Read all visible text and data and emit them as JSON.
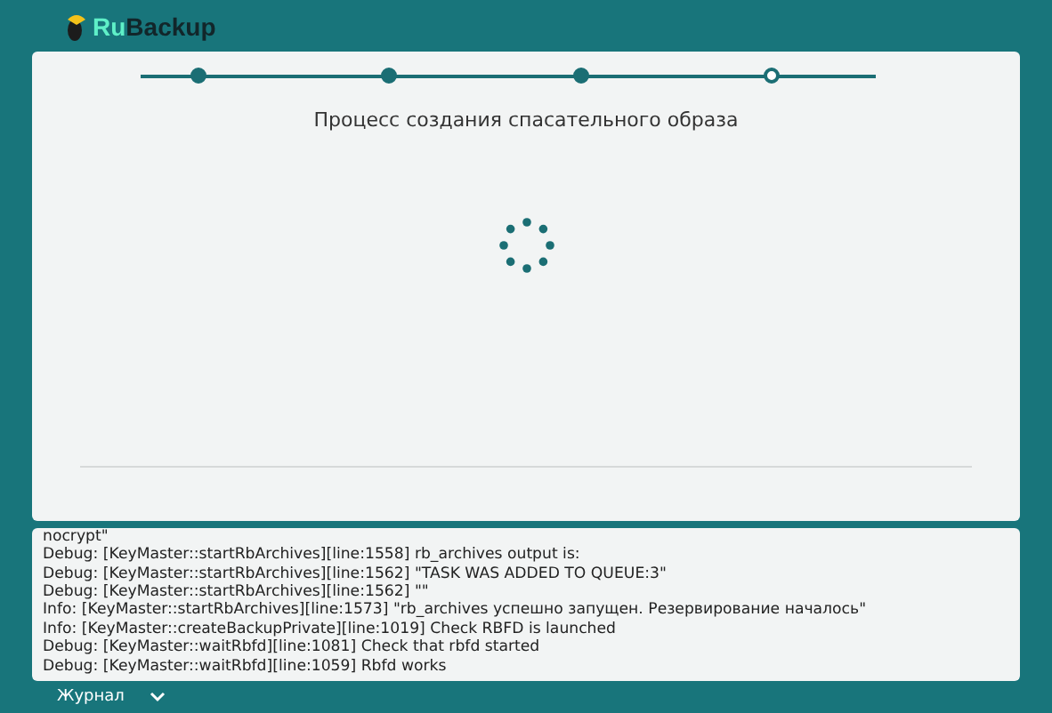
{
  "app": {
    "logo_prefix": "Ru",
    "logo_suffix": "Backup"
  },
  "steps": [
    {
      "done": true
    },
    {
      "done": true
    },
    {
      "done": true
    },
    {
      "done": false
    }
  ],
  "title": "Процесс создания спасательного образа",
  "log": [
    "nocrypt\"",
    "Debug: [KeyMaster::startRbArchives][line:1558] rb_archives output is:",
    "Debug: [KeyMaster::startRbArchives][line:1562] \"TASK WAS ADDED TO QUEUE:3\"",
    "Debug: [KeyMaster::startRbArchives][line:1562] \"\"",
    "Info: [KeyMaster::startRbArchives][line:1573] \"rb_archives успешно запущен. Резервирование началось\"",
    "Info: [KeyMaster::createBackupPrivate][line:1019] Check RBFD is launched",
    "Debug: [KeyMaster::waitRbfd][line:1081] Check that rbfd started",
    "Debug: [KeyMaster::waitRbfd][line:1059] Rbfd works"
  ],
  "footer": {
    "label": "Журнал",
    "expanded": false
  }
}
